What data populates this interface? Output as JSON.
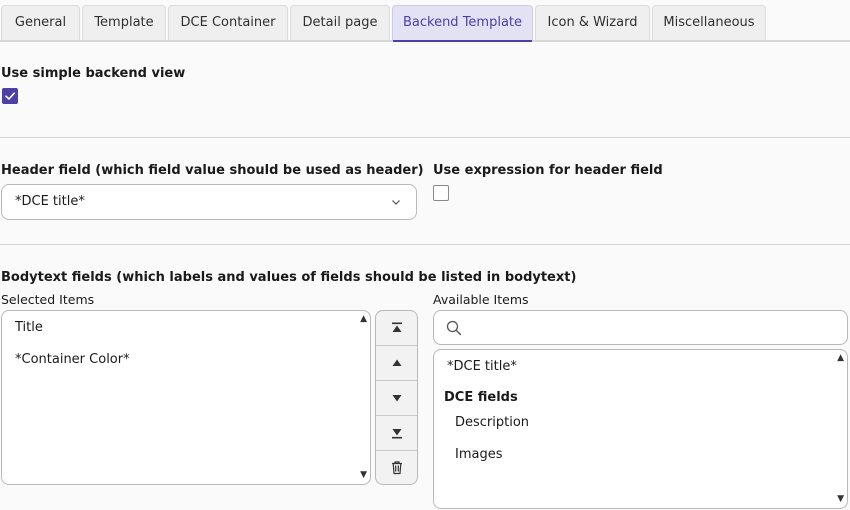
{
  "tabs": [
    {
      "label": "General"
    },
    {
      "label": "Template"
    },
    {
      "label": "DCE Container"
    },
    {
      "label": "Detail page"
    },
    {
      "label": "Backend Template"
    },
    {
      "label": "Icon & Wizard"
    },
    {
      "label": "Miscellaneous"
    }
  ],
  "active_tab": "Backend Template",
  "simple_backend": {
    "label": "Use simple backend view",
    "checked": true
  },
  "header_field": {
    "label": "Header field (which field value should be used as header)",
    "value": "*DCE title*"
  },
  "use_expression": {
    "label": "Use expression for header field",
    "checked": false
  },
  "bodytext": {
    "label": "Bodytext fields (which labels and values of fields should be listed in bodytext)",
    "selected_label": "Selected Items",
    "available_label": "Available Items",
    "selected_items": [
      "Title",
      "*Container Color*"
    ],
    "available_top": "*DCE title*",
    "available_group": "DCE fields",
    "available_items": [
      "Description",
      "Images"
    ]
  },
  "colors": {
    "accent": "#4d3fa3",
    "active_tab_bg": "#e3e1f4"
  }
}
